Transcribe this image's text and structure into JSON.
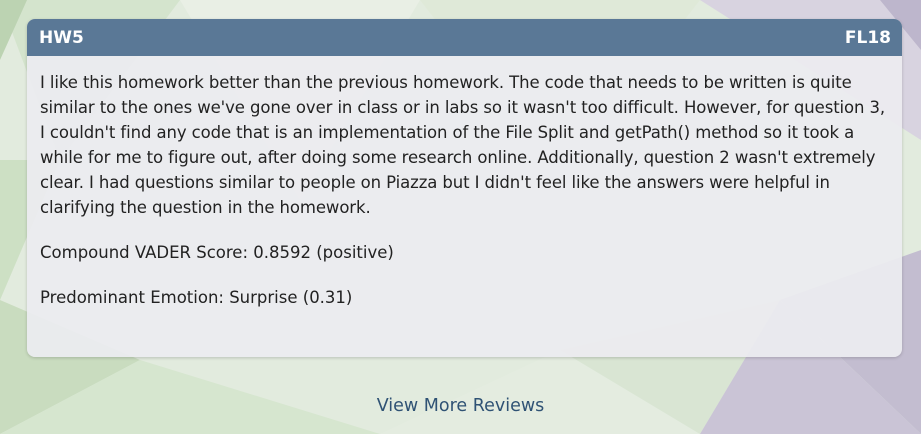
{
  "card": {
    "title": "HW5",
    "term": "FL18",
    "review_text": "I like this homework better than the previous homework. The code that needs to be written is quite similar to the ones we've gone over in class or in labs so it wasn't too difficult. However, for question 3, I couldn't find any code that is an implementation of the File Split and getPath() method so it took a while for me to figure out, after doing some research online. Additionally, question 2 wasn't extremely clear. I had questions similar to people on Piazza but I didn't feel like the answers were helpful in clarifying the question in the homework.",
    "vader_label": "Compound VADER Score: 0.8592 (positive)",
    "emotion_label": "Predominant Emotion: Surprise (0.31)"
  },
  "footer": {
    "view_more_label": "View More Reviews"
  },
  "colors": {
    "header_bg": "#5a7896",
    "link": "#2f5274",
    "background_green": "#cfe3c8",
    "background_purple": "#b9b2c9"
  }
}
